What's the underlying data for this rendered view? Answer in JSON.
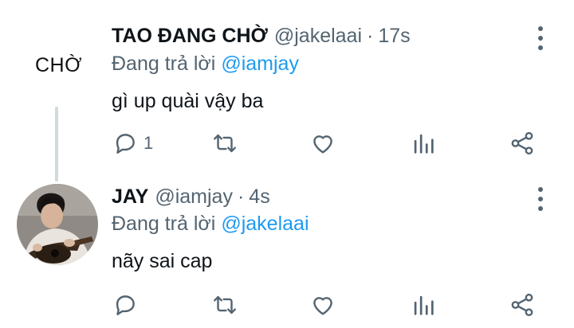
{
  "tweets": [
    {
      "name": "TAO ĐANG CHỜ",
      "handle": "@jakelaai",
      "separator": "·",
      "time": "17s",
      "reply_prefix": "Đang trả lời",
      "reply_to": "@iamjay",
      "text": "gì up quài vậy ba",
      "avatar_text": "CHỜ",
      "reply_count": "1"
    },
    {
      "name": "JAY",
      "handle": "@iamjay",
      "separator": "·",
      "time": "4s",
      "reply_prefix": "Đang trả lời",
      "reply_to": "@jakelaai",
      "text": "nãy sai cap",
      "reply_count": ""
    }
  ],
  "icons": {
    "reply": "reply-icon",
    "retweet": "retweet-icon",
    "like": "like-icon",
    "stats": "stats-icon",
    "share": "share-icon",
    "more": "more-vertical-icon"
  },
  "colors": {
    "icon": "#536471",
    "mention": "#1d9bf0",
    "thread_line": "#cfd9de"
  }
}
